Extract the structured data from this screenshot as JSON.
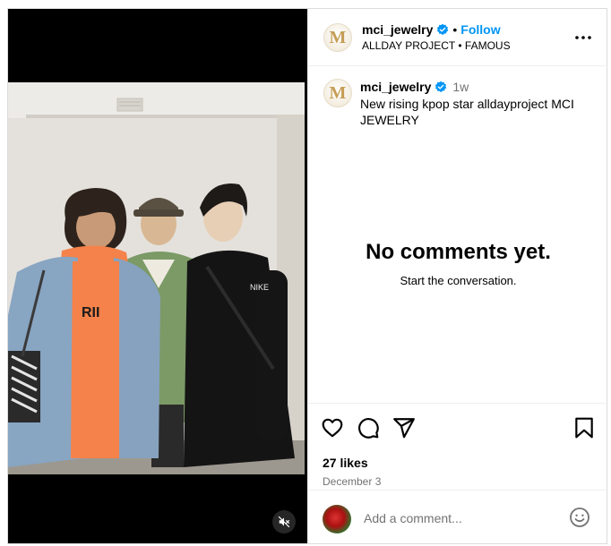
{
  "post": {
    "account": {
      "username": "mci_jewelry",
      "avatar_letter": "M",
      "follow_label": "Follow",
      "separator": "•",
      "audio_line": "ALLDAY PROJECT • FAMOUS"
    },
    "caption": {
      "username": "mci_jewelry",
      "time": "1w",
      "text": "New rising kpop star alldayproject MCI JEWELRY"
    },
    "comments": {
      "empty_title": "No comments yet.",
      "empty_subtitle": "Start the conversation."
    },
    "likes": "27 likes",
    "date": "December 3",
    "comment_input": {
      "placeholder": "Add a comment..."
    }
  },
  "icons": {
    "verified": "verified-badge-icon",
    "more": "more-options-icon",
    "like": "heart-icon",
    "comment": "comment-bubble-icon",
    "share": "paper-plane-icon",
    "save": "bookmark-icon",
    "emoji": "emoji-smiley-icon",
    "mute": "muted-speaker-icon"
  },
  "colors": {
    "link": "#0095f6",
    "verified": "#0095f6",
    "secondary_text": "#737373",
    "border": "#dbdbdb",
    "media_background": "#000000"
  }
}
